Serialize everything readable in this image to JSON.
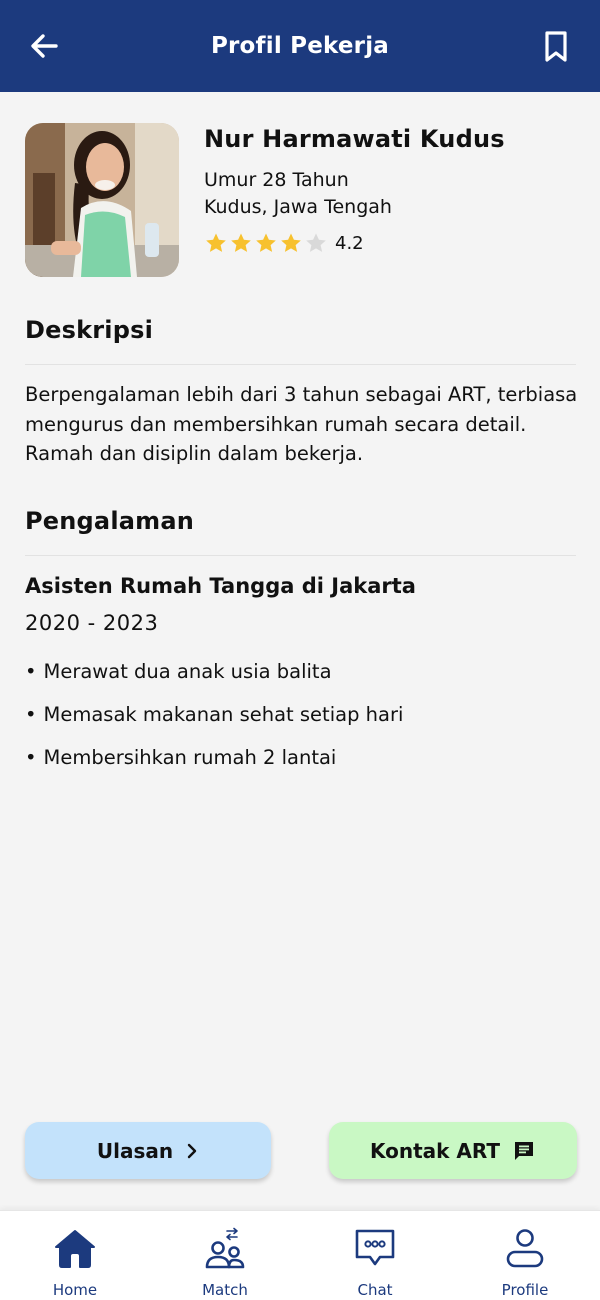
{
  "header": {
    "title": "Profil Pekerja"
  },
  "profile": {
    "name": "Nur Harmawati Kudus",
    "age": "Umur 28 Tahun",
    "location": "Kudus, Jawa Tengah",
    "rating": 4.2,
    "rating_text": "4.2"
  },
  "description": {
    "title": "Deskripsi",
    "text": "Berpengalaman lebih dari 3 tahun sebagai ART, terbiasa mengurus dan membersihkan rumah secara detail. Ramah dan disiplin dalam bekerja."
  },
  "experience": {
    "title": "Pengalaman",
    "job_title": "Asisten Rumah Tangga di Jakarta",
    "period": "2020 - 2023",
    "items": [
      "Merawat dua anak usia balita",
      "Memasak makanan sehat setiap hari",
      "Membersihkan rumah 2 lantai"
    ]
  },
  "actions": {
    "reviews_label": "Ulasan",
    "contact_label": "Kontak ART"
  },
  "bottom_nav": [
    {
      "label": "Home",
      "icon": "home-icon"
    },
    {
      "label": "Match",
      "icon": "match-icon"
    },
    {
      "label": "Chat",
      "icon": "chat-icon"
    },
    {
      "label": "Profile",
      "icon": "profile-icon"
    }
  ],
  "colors": {
    "primary": "#1c3a7e",
    "star_filled": "#f7c12e",
    "star_empty": "#d9d9d9",
    "reviews_button": "#c3e2fb",
    "contact_button": "#c9f8c4"
  }
}
